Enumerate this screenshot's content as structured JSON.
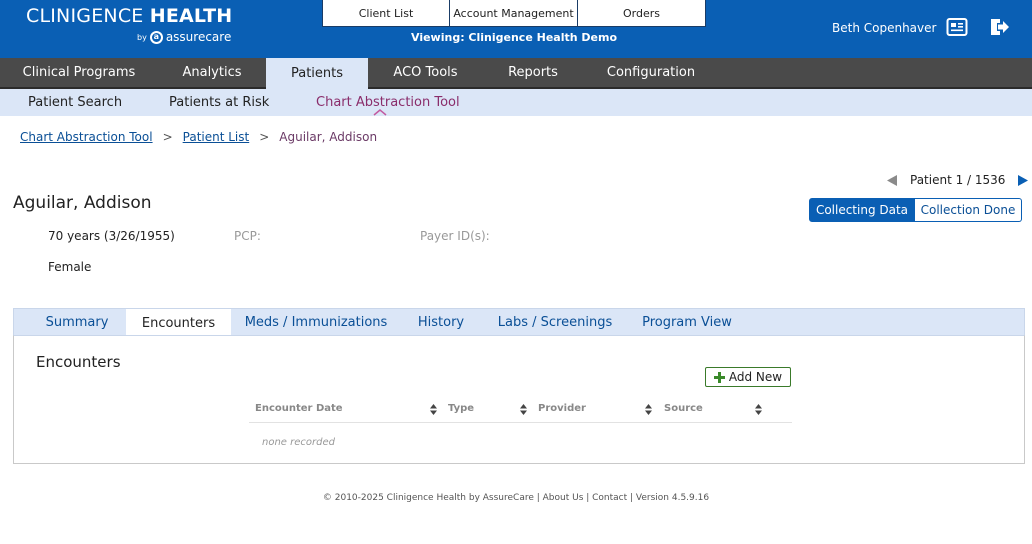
{
  "brand": {
    "name_light": "CLINIGENCE ",
    "name_bold": "HEALTH",
    "by": "by",
    "partner": "assurecare"
  },
  "top_nav": {
    "items": [
      {
        "label": "Client List"
      },
      {
        "label": "Account Management"
      },
      {
        "label": "Orders"
      }
    ],
    "viewing": "Viewing: Clinigence Health Demo"
  },
  "user": {
    "name": "Beth Copenhaver",
    "icons": [
      "id-card-icon",
      "sign-out-icon"
    ]
  },
  "main_nav": {
    "items": [
      {
        "label": "Clinical Programs"
      },
      {
        "label": "Analytics"
      },
      {
        "label": "Patients"
      },
      {
        "label": "ACO Tools"
      },
      {
        "label": "Reports"
      },
      {
        "label": "Configuration"
      }
    ],
    "active": "Patients"
  },
  "sub_nav": {
    "items": [
      {
        "label": "Patient Search"
      },
      {
        "label": "Patients at Risk"
      },
      {
        "label": "Chart Abstraction Tool"
      }
    ],
    "active": "Chart Abstraction Tool"
  },
  "breadcrumb": {
    "items": [
      "Chart Abstraction Tool",
      "Patient List"
    ],
    "separator": ">",
    "current": "Aguilar, Addison"
  },
  "pager": {
    "text": "Patient 1 / 1536"
  },
  "status_toggle": {
    "options": [
      "Collecting Data",
      "Collection Done"
    ],
    "selected": "Collecting Data"
  },
  "patient": {
    "name": "Aguilar, Addison",
    "age_dob": "70 years (3/26/1955)",
    "pcp_label": "PCP:",
    "payer_label": "Payer ID(s):",
    "sex": "Female"
  },
  "tabs": {
    "items": [
      {
        "label": "Summary"
      },
      {
        "label": "Encounters"
      },
      {
        "label": "Meds / Immunizations"
      },
      {
        "label": "History"
      },
      {
        "label": "Labs / Screenings"
      },
      {
        "label": "Program View"
      }
    ],
    "active": "Encounters"
  },
  "encounters": {
    "title": "Encounters",
    "add_label": "Add New",
    "columns": [
      "Encounter Date",
      "Type",
      "Provider",
      "Source"
    ],
    "empty_text": "none recorded"
  },
  "footer": {
    "text": "© 2010-2025 Clinigence Health by AssureCare | About Us | Contact | Version 4.5.9.16"
  },
  "colors": {
    "header_blue": "#0a5fb4",
    "nav_dark": "#4a4a4a",
    "sub_nav_bg": "#dbe6f7",
    "active_subnav_text": "#8a2d6b",
    "add_button_green": "#3a7a2a"
  }
}
